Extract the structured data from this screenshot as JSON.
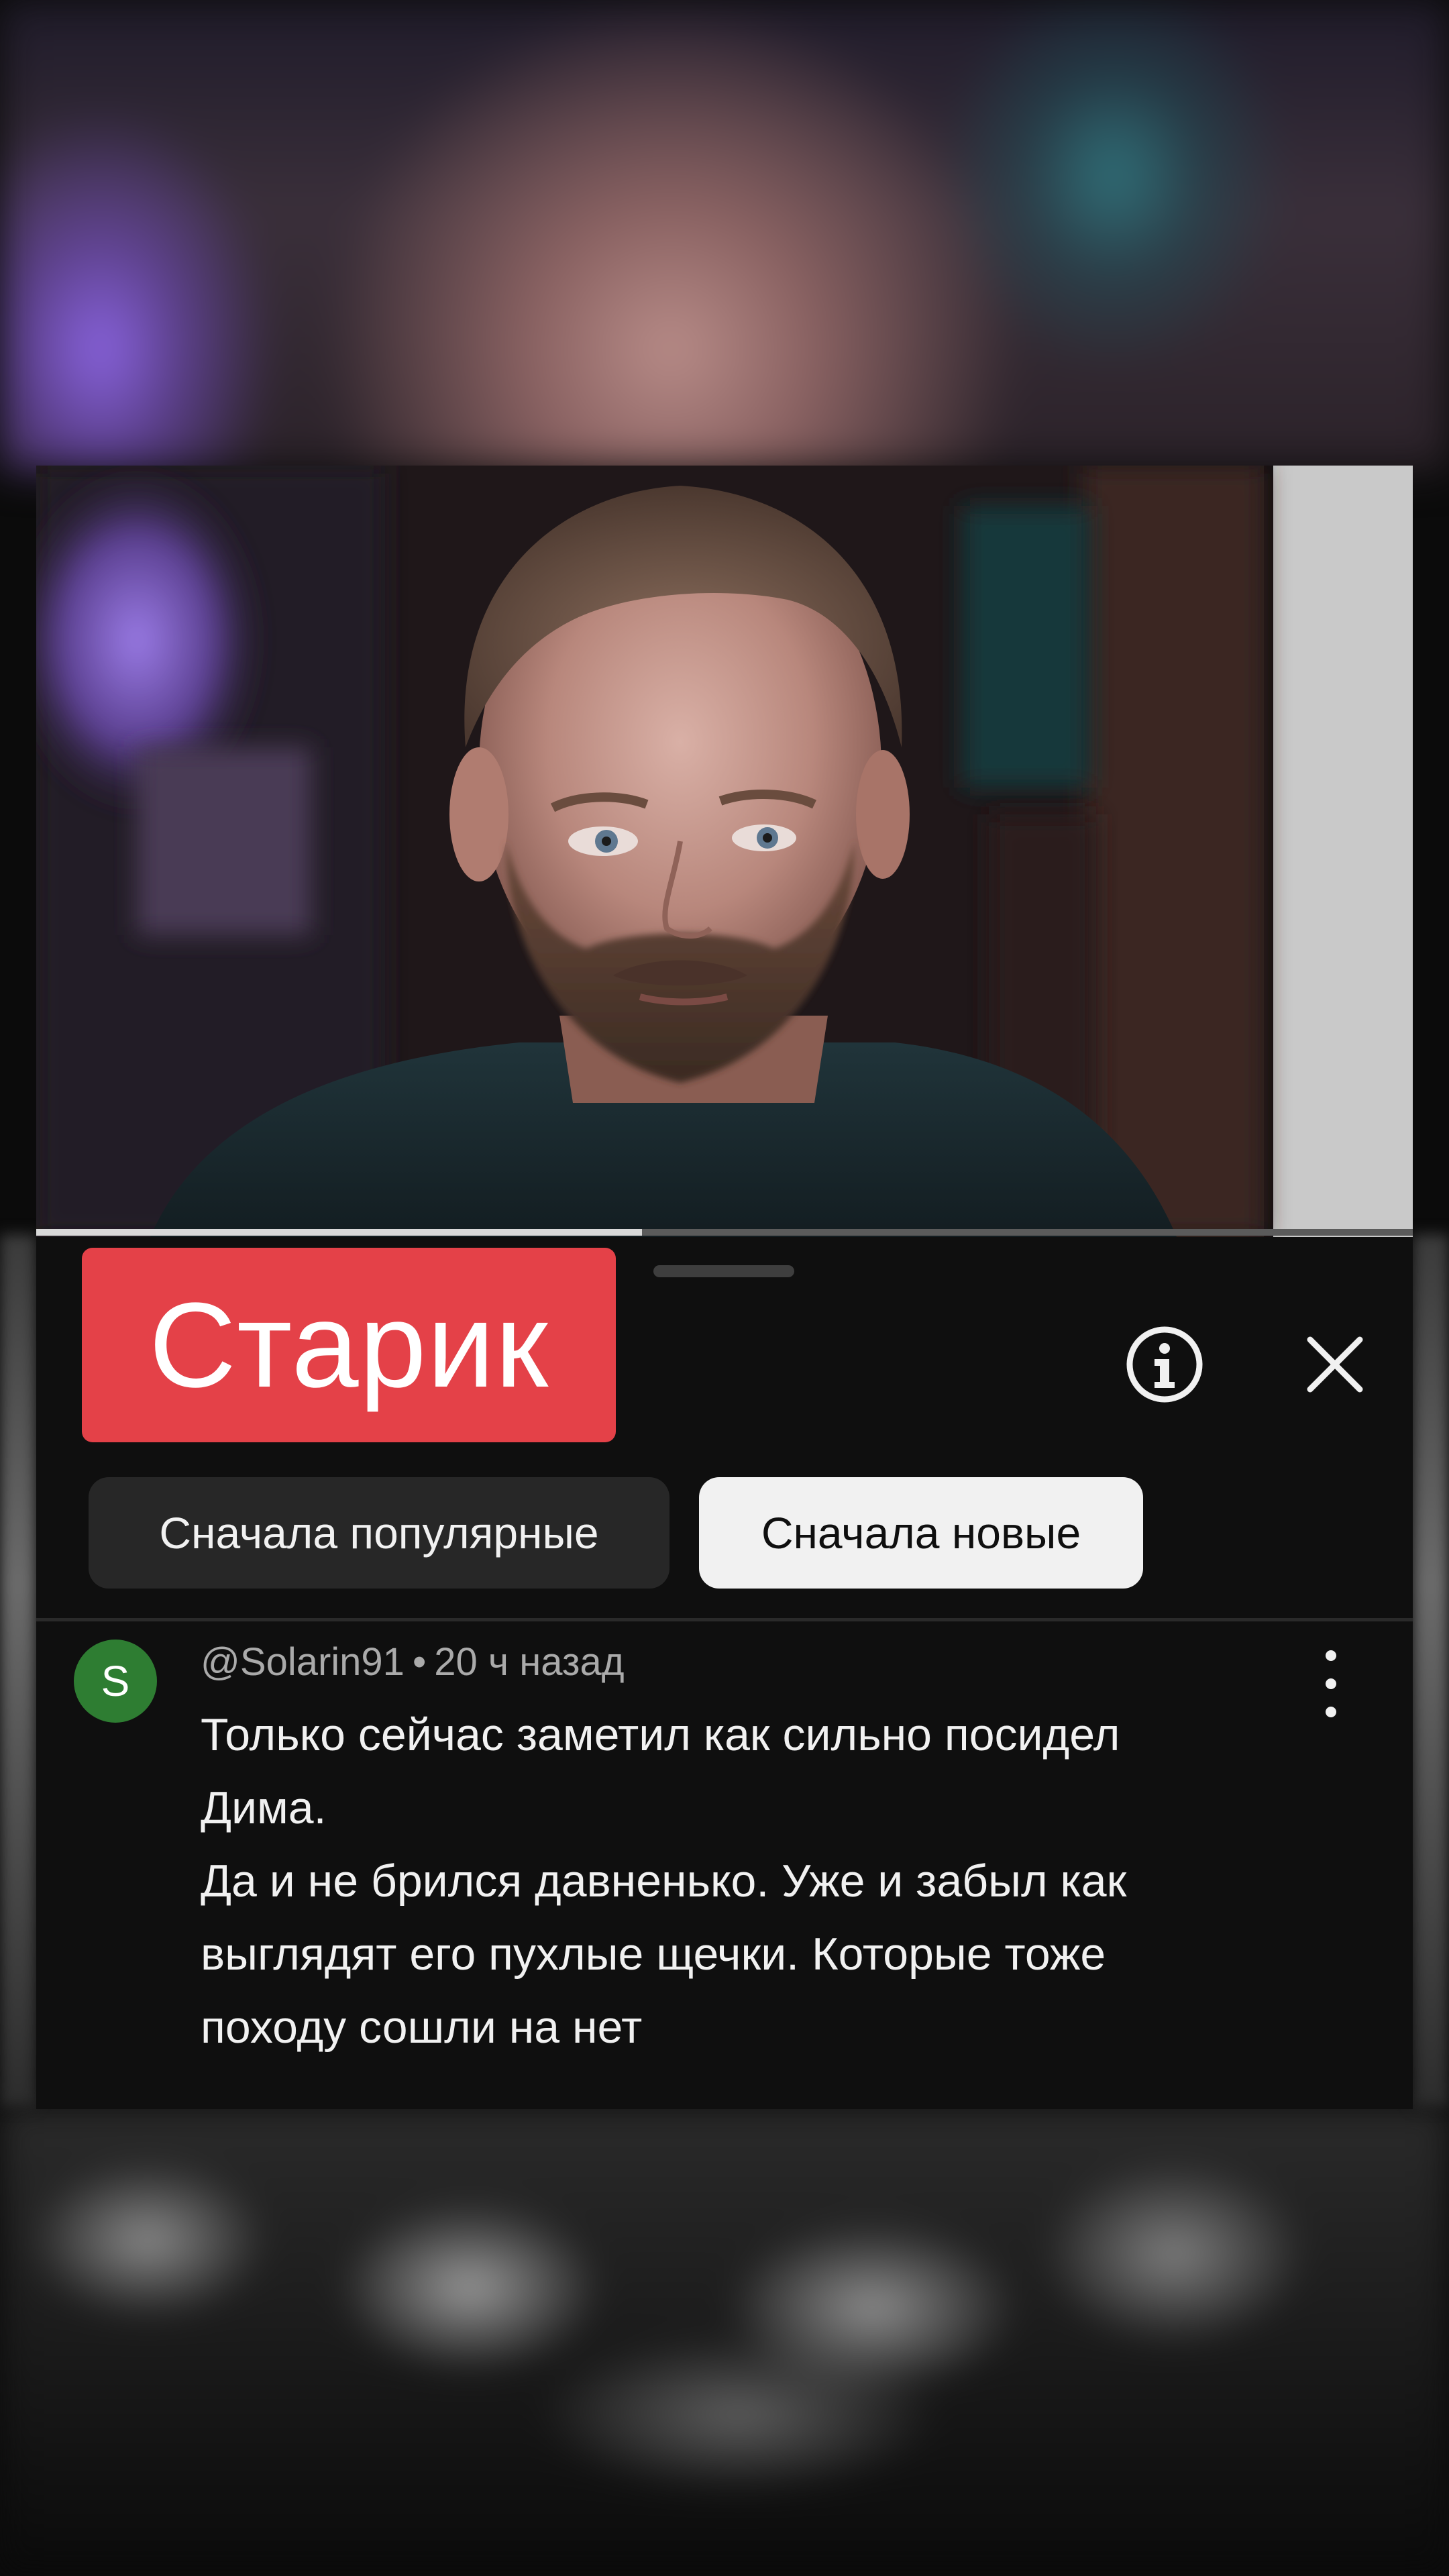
{
  "video": {
    "progress_fraction": 0.44
  },
  "sheet": {
    "title": "Старик",
    "info_icon": "info-icon",
    "close_icon": "close-icon",
    "sort_chips": [
      {
        "label": "Сначала популярные",
        "selected": false
      },
      {
        "label": "Сначала новые",
        "selected": true
      }
    ]
  },
  "comment": {
    "avatar_letter": "S",
    "avatar_color": "#2e7d32",
    "author": "@Solarin91",
    "separator": "•",
    "time": "20 ч назад",
    "lines": [
      "Только сейчас заметил как сильно посидел",
      "Дима.",
      "Да и не брился давненько. Уже и забыл как",
      "выглядят его пухлые щечки. Которые тоже",
      "походу сошли на нет"
    ],
    "menu_icon": "more-vert-icon"
  },
  "colors": {
    "title_badge": "#e44148",
    "sheet_background": "#0f0f0f",
    "chip_selected": "#f1f1f1",
    "chip_unselected": "#272727"
  }
}
